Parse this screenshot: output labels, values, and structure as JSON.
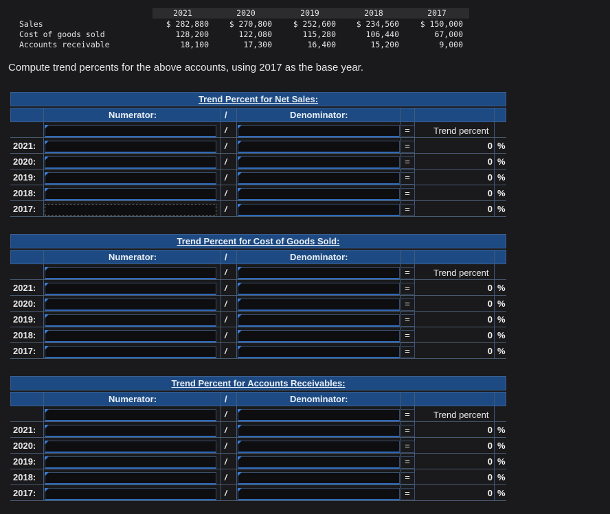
{
  "data_table": {
    "years": [
      "2021",
      "2020",
      "2019",
      "2018",
      "2017"
    ],
    "rows": [
      {
        "label": "Sales",
        "values": [
          "$ 282,880",
          "$ 270,800",
          "$ 252,600",
          "$ 234,560",
          "$ 150,000"
        ]
      },
      {
        "label": "Cost of goods sold",
        "values": [
          "128,200",
          "122,080",
          "115,280",
          "106,440",
          "67,000"
        ]
      },
      {
        "label": "Accounts receivable",
        "values": [
          "18,100",
          "17,300",
          "16,400",
          "15,200",
          "9,000"
        ]
      }
    ]
  },
  "instruction": "Compute trend percents for the above accounts, using 2017 as the base year.",
  "sections": [
    {
      "title": "Trend Percent for Net Sales:",
      "numerator_label": "Numerator:",
      "denominator_label": "Denominator:",
      "slash": "/",
      "equals": "=",
      "trend_label": "Trend percent",
      "rows": [
        {
          "year": "2021:",
          "result": "0",
          "pct": "%"
        },
        {
          "year": "2020:",
          "result": "0",
          "pct": "%"
        },
        {
          "year": "2019:",
          "result": "0",
          "pct": "%"
        },
        {
          "year": "2018:",
          "result": "0",
          "pct": "%"
        },
        {
          "year": "2017:",
          "result": "0",
          "pct": "%"
        }
      ]
    },
    {
      "title": "Trend Percent for Cost of Goods Sold:",
      "numerator_label": "Numerator:",
      "denominator_label": "Denominator:",
      "slash": "/",
      "equals": "=",
      "trend_label": "Trend percent",
      "rows": [
        {
          "year": "2021:",
          "result": "0",
          "pct": "%"
        },
        {
          "year": "2020:",
          "result": "0",
          "pct": "%"
        },
        {
          "year": "2019:",
          "result": "0",
          "pct": "%"
        },
        {
          "year": "2018:",
          "result": "0",
          "pct": "%"
        },
        {
          "year": "2017:",
          "result": "0",
          "pct": "%"
        }
      ]
    },
    {
      "title": "Trend Percent for Accounts Receivables:",
      "numerator_label": "Numerator:",
      "denominator_label": "Denominator:",
      "slash": "/",
      "equals": "=",
      "trend_label": "Trend percent",
      "rows": [
        {
          "year": "2021:",
          "result": "0",
          "pct": "%"
        },
        {
          "year": "2020:",
          "result": "0",
          "pct": "%"
        },
        {
          "year": "2019:",
          "result": "0",
          "pct": "%"
        },
        {
          "year": "2018:",
          "result": "0",
          "pct": "%"
        },
        {
          "year": "2017:",
          "result": "0",
          "pct": "%"
        }
      ]
    }
  ]
}
